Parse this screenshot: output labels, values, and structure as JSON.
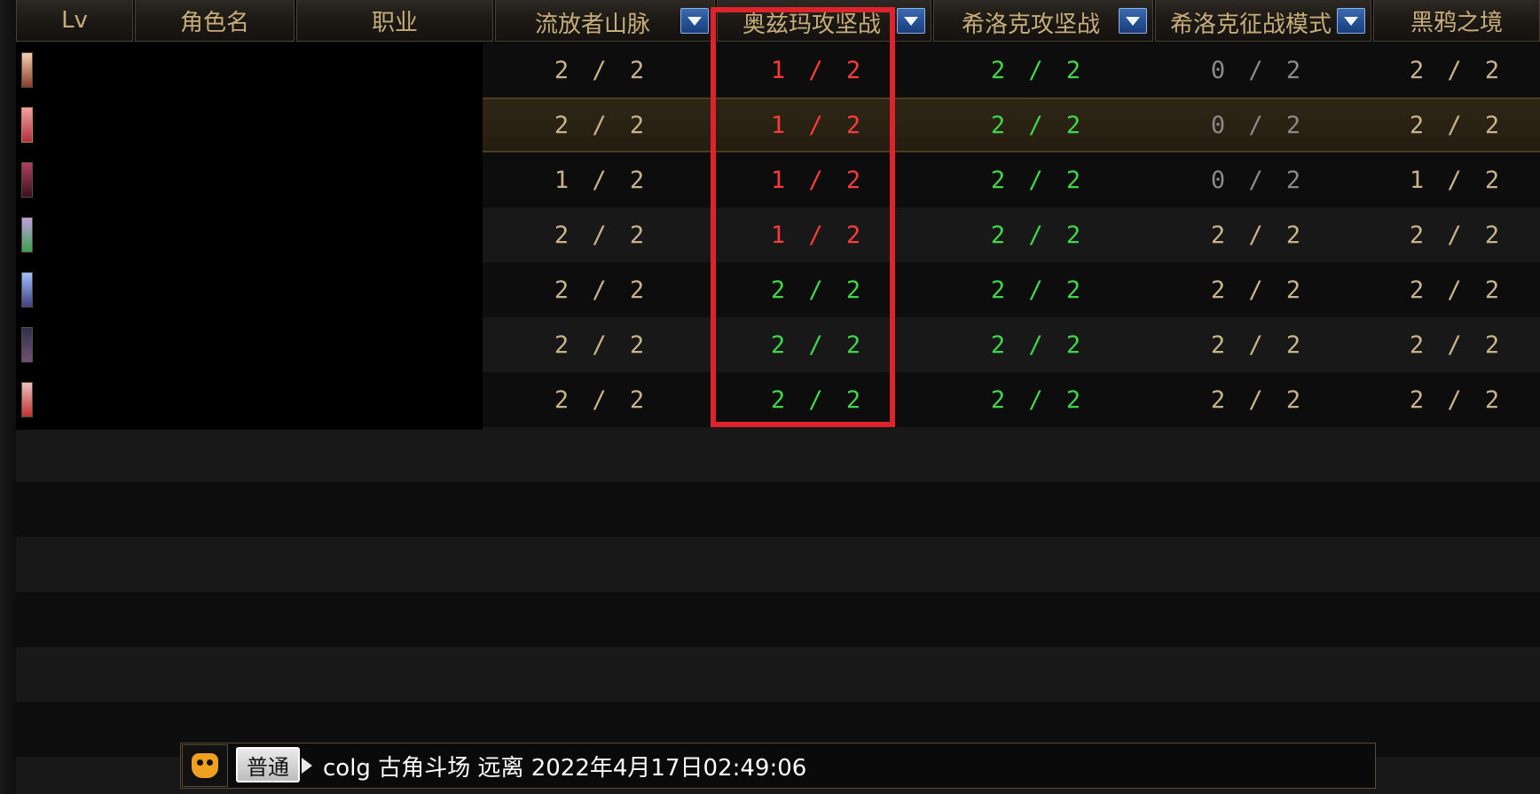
{
  "colors": {
    "header_text": "#c7ad7a",
    "value_tan": "#c9b38a",
    "value_red": "#ff3b3b",
    "value_green": "#3fd74a",
    "value_gray": "#8a8a8a",
    "highlight": "#e0222a"
  },
  "table": {
    "headers": [
      {
        "key": "lv",
        "label": "Lv",
        "has_dropdown": false
      },
      {
        "key": "name",
        "label": "角色名",
        "has_dropdown": false
      },
      {
        "key": "class",
        "label": "职业",
        "has_dropdown": false
      },
      {
        "key": "exile_mountains",
        "label": "流放者山脉",
        "has_dropdown": true
      },
      {
        "key": "ozma_raid",
        "label": "奥兹玛攻坚战",
        "has_dropdown": true
      },
      {
        "key": "sirocco_raid",
        "label": "希洛克攻坚战",
        "has_dropdown": true
      },
      {
        "key": "sirocco_sim",
        "label": "希洛克征战模式",
        "has_dropdown": true
      },
      {
        "key": "black_crow",
        "label": "黑鸦之境",
        "has_dropdown": false
      }
    ],
    "rows": [
      {
        "selected": false,
        "cells": [
          {
            "text": "2 / 2",
            "color": "tan"
          },
          {
            "text": "1 / 2",
            "color": "red"
          },
          {
            "text": "2 / 2",
            "color": "green"
          },
          {
            "text": "0 / 2",
            "color": "gray"
          },
          {
            "text": "2 / 2",
            "color": "tan"
          }
        ]
      },
      {
        "selected": true,
        "cells": [
          {
            "text": "2 / 2",
            "color": "tan"
          },
          {
            "text": "1 / 2",
            "color": "red"
          },
          {
            "text": "2 / 2",
            "color": "green"
          },
          {
            "text": "0 / 2",
            "color": "gray"
          },
          {
            "text": "2 / 2",
            "color": "tan"
          }
        ]
      },
      {
        "selected": false,
        "cells": [
          {
            "text": "1 / 2",
            "color": "tan"
          },
          {
            "text": "1 / 2",
            "color": "red"
          },
          {
            "text": "2 / 2",
            "color": "green"
          },
          {
            "text": "0 / 2",
            "color": "gray"
          },
          {
            "text": "1 / 2",
            "color": "tan"
          }
        ]
      },
      {
        "selected": false,
        "cells": [
          {
            "text": "2 / 2",
            "color": "tan"
          },
          {
            "text": "1 / 2",
            "color": "red"
          },
          {
            "text": "2 / 2",
            "color": "green"
          },
          {
            "text": "2 / 2",
            "color": "tan"
          },
          {
            "text": "2 / 2",
            "color": "tan"
          }
        ]
      },
      {
        "selected": false,
        "cells": [
          {
            "text": "2 / 2",
            "color": "tan"
          },
          {
            "text": "2 / 2",
            "color": "green"
          },
          {
            "text": "2 / 2",
            "color": "green"
          },
          {
            "text": "2 / 2",
            "color": "tan"
          },
          {
            "text": "2 / 2",
            "color": "tan"
          }
        ]
      },
      {
        "selected": false,
        "cells": [
          {
            "text": "2 / 2",
            "color": "tan"
          },
          {
            "text": "2 / 2",
            "color": "green"
          },
          {
            "text": "2 / 2",
            "color": "green"
          },
          {
            "text": "2 / 2",
            "color": "tan"
          },
          {
            "text": "2 / 2",
            "color": "tan"
          }
        ]
      },
      {
        "selected": false,
        "cells": [
          {
            "text": "2 / 2",
            "color": "tan"
          },
          {
            "text": "2 / 2",
            "color": "green"
          },
          {
            "text": "2 / 2",
            "color": "green"
          },
          {
            "text": "2 / 2",
            "color": "tan"
          },
          {
            "text": "2 / 2",
            "color": "tan"
          }
        ]
      }
    ]
  },
  "chat": {
    "emoji_icon": "emoji-face-icon",
    "mode_label": "普通",
    "message": "colg 古角斗场 远离 2022年4月17日02:49:06"
  }
}
